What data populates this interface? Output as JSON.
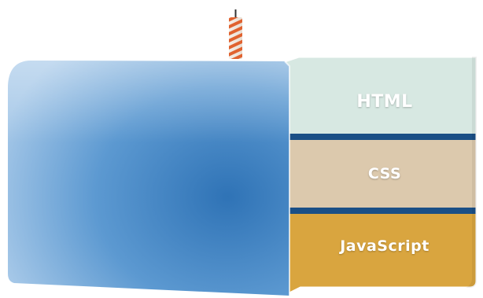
{
  "layers": [
    {
      "label": "HTML",
      "color": "#d7e8e2"
    },
    {
      "label": "CSS",
      "color": "#dcc9ad"
    },
    {
      "label": "JavaScript",
      "color": "#d9a53f"
    }
  ],
  "colors": {
    "cake_body": "#5b9bd5",
    "cake_body_dark": "#2f73b6",
    "layer_separator": "#1a4f86",
    "candle_stripe": "#e0622f",
    "candle_base": "#f3ede6",
    "wick": "#333333"
  }
}
